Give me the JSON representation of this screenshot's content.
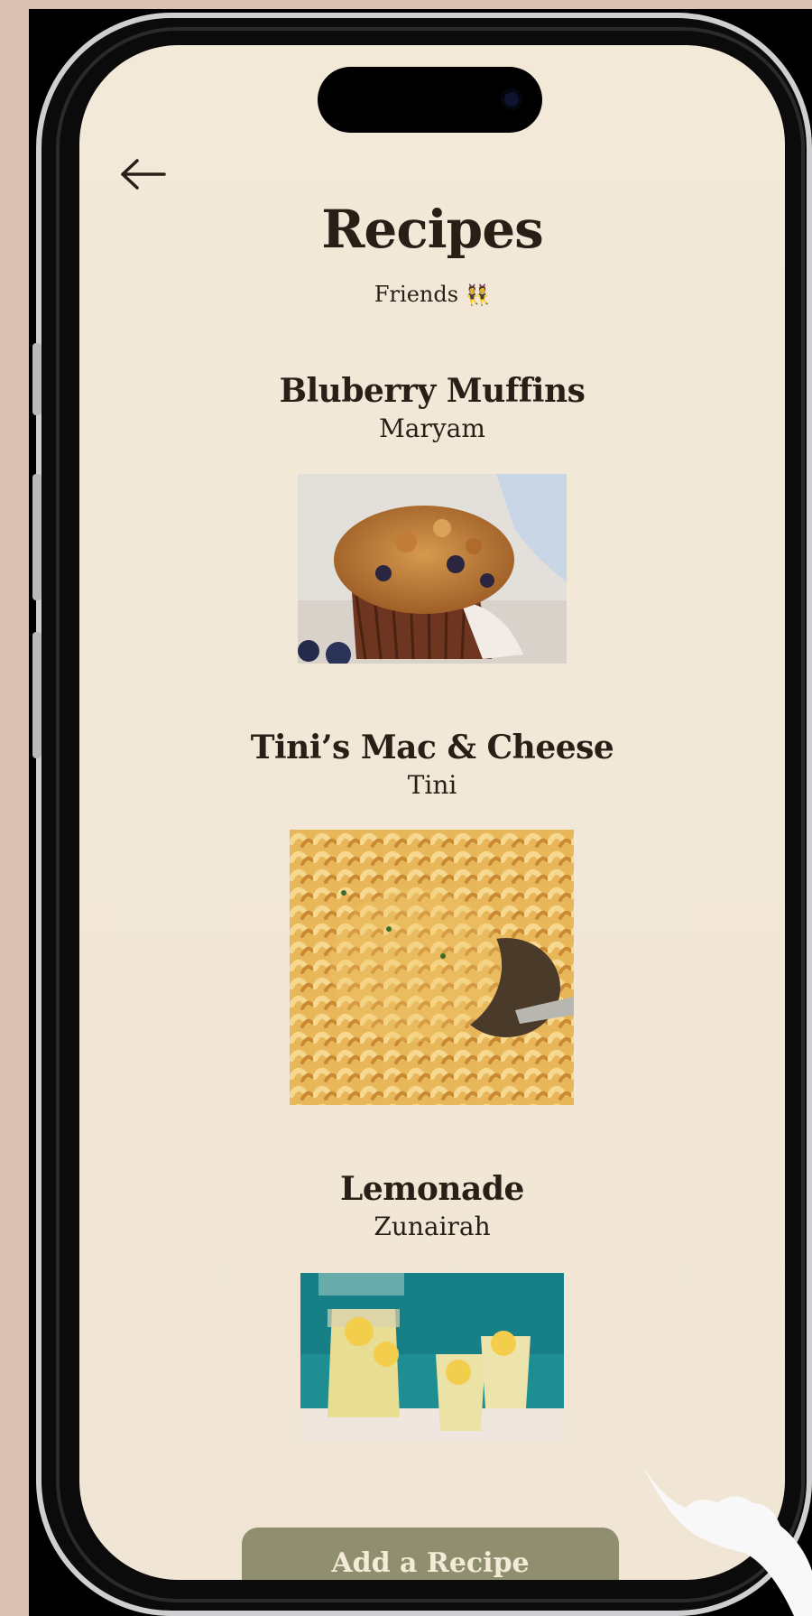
{
  "header": {
    "title": "Recipes",
    "subtitle": "Friends",
    "subtitle_emoji": "👯"
  },
  "recipes": [
    {
      "title": "Bluberry Muffins",
      "author": "Maryam",
      "image": "blueberry-muffin-photo"
    },
    {
      "title": "Tini’s Mac & Cheese",
      "author": "Tini",
      "image": "mac-and-cheese-photo"
    },
    {
      "title": "Lemonade",
      "author": "Zunairah",
      "image": "lemonade-photo"
    }
  ],
  "actions": {
    "add_label": "Add a Recipe"
  },
  "colors": {
    "background": "#f2e8d8",
    "text": "#2a1f17",
    "button": "#8f8f70",
    "button_text": "#f3ead8"
  },
  "icons": {
    "back": "back-arrow-icon"
  }
}
